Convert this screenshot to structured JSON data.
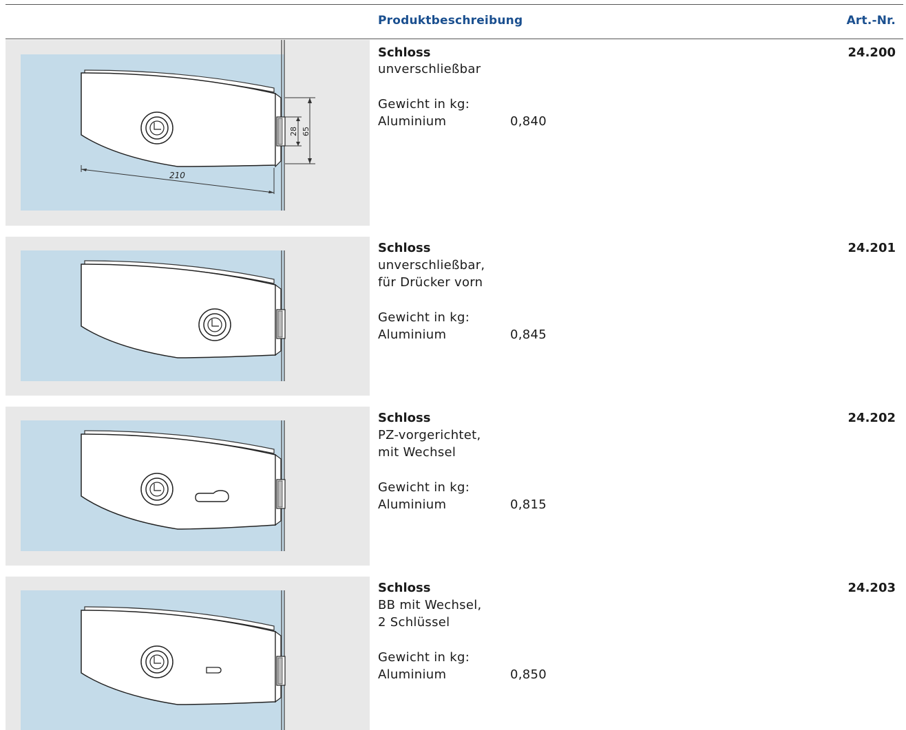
{
  "header": {
    "description_label": "Produktbeschreibung",
    "art_label": "Art.-Nr."
  },
  "products": [
    {
      "title": "Schloss",
      "desc_lines": [
        "unverschließbar"
      ],
      "weight_label": "Gewicht in kg:",
      "material": "Aluminium",
      "weight": "0,840",
      "art_nr": "24.200",
      "dimensions": {
        "width": "210",
        "latch": "28",
        "height": "65"
      }
    },
    {
      "title": "Schloss",
      "desc_lines": [
        "unverschließbar,",
        "für Drücker vorn"
      ],
      "weight_label": "Gewicht in kg:",
      "material": "Aluminium",
      "weight": "0,845",
      "art_nr": "24.201"
    },
    {
      "title": "Schloss",
      "desc_lines": [
        "PZ-vorgerichtet,",
        "mit Wechsel"
      ],
      "weight_label": "Gewicht in kg:",
      "material": "Aluminium",
      "weight": "0,815",
      "art_nr": "24.202"
    },
    {
      "title": "Schloss",
      "desc_lines": [
        "BB mit Wechsel,",
        "2 Schlüssel"
      ],
      "weight_label": "Gewicht in kg:",
      "material": "Aluminium",
      "weight": "0,850",
      "art_nr": "24.203"
    }
  ],
  "colors": {
    "header_blue": "#1a4f8f",
    "glass_blue": "#c4dbe9",
    "panel_gray": "#e8e8e8"
  }
}
